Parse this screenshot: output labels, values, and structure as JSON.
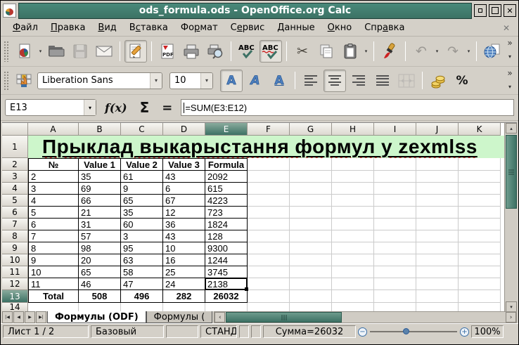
{
  "window": {
    "title": "ods_formula.ods - OpenOffice.org Calc",
    "close_glyph": "✕"
  },
  "menu": {
    "items": [
      {
        "name": "file",
        "pre": "",
        "key": "Ф",
        "post": "айл"
      },
      {
        "name": "edit",
        "pre": "",
        "key": "П",
        "post": "равка"
      },
      {
        "name": "view",
        "pre": "",
        "key": "В",
        "post": "ид"
      },
      {
        "name": "insert",
        "pre": "В",
        "key": "с",
        "post": "тавка"
      },
      {
        "name": "format",
        "pre": "Фо",
        "key": "р",
        "post": "мат"
      },
      {
        "name": "tools",
        "pre": "С",
        "key": "е",
        "post": "рвис"
      },
      {
        "name": "data",
        "pre": "",
        "key": "Д",
        "post": "анные"
      },
      {
        "name": "window",
        "pre": "",
        "key": "О",
        "post": "кно"
      },
      {
        "name": "help",
        "pre": "Спр",
        "key": "а",
        "post": "вка"
      }
    ],
    "close_glyph": "✕"
  },
  "glyphs": {
    "dropdown": "▾",
    "overflow": "»",
    "cut": "✂",
    "undo": "↶",
    "redo": "↷",
    "percent": "%",
    "up": "▴",
    "down": "▾",
    "left": "‹",
    "right": "›",
    "minus": "−",
    "plus": "+"
  },
  "format_toolbar": {
    "font_name": "Liberation Sans",
    "font_size": "10"
  },
  "formula_bar": {
    "cell_ref": "E13",
    "fx_label": "f(x)",
    "sigma_label": "Σ",
    "equals_label": "=",
    "formula": "=SUM(E3:E12)"
  },
  "grid": {
    "col_headers": [
      "A",
      "B",
      "C",
      "D",
      "E",
      "F",
      "G",
      "H",
      "I",
      "J",
      "K"
    ],
    "selected_col": "E",
    "selected_row": 13,
    "row_count": 14,
    "title": "Прыклад выкарыстання формул у zexmlss",
    "table": {
      "headers": [
        "№",
        "Value 1",
        "Value 2",
        "Value 3",
        "Formula"
      ],
      "rows": [
        [
          "2",
          "35",
          "61",
          "43",
          "2092"
        ],
        [
          "3",
          "69",
          "9",
          "6",
          "615"
        ],
        [
          "4",
          "66",
          "65",
          "67",
          "4223"
        ],
        [
          "5",
          "21",
          "35",
          "12",
          "723"
        ],
        [
          "6",
          "31",
          "60",
          "36",
          "1824"
        ],
        [
          "7",
          "57",
          "3",
          "43",
          "128"
        ],
        [
          "8",
          "98",
          "95",
          "10",
          "9300"
        ],
        [
          "9",
          "20",
          "63",
          "16",
          "1244"
        ],
        [
          "10",
          "65",
          "58",
          "25",
          "3745"
        ],
        [
          "11",
          "46",
          "47",
          "24",
          "2138"
        ]
      ],
      "total": [
        "Total",
        "508",
        "496",
        "282",
        "26032"
      ]
    }
  },
  "tabs": {
    "nav": [
      "|◀",
      "◀",
      "▶",
      "▶|"
    ],
    "sheets": [
      {
        "label": "Формулы (ODF)",
        "active": true
      },
      {
        "label": "Формулы (",
        "active": false
      }
    ]
  },
  "status": {
    "sheet": "Лист 1 / 2",
    "page_style": "Базовый",
    "insert_mode": "СТАНД",
    "sum": "Сумма=26032",
    "zoom": "100%"
  }
}
